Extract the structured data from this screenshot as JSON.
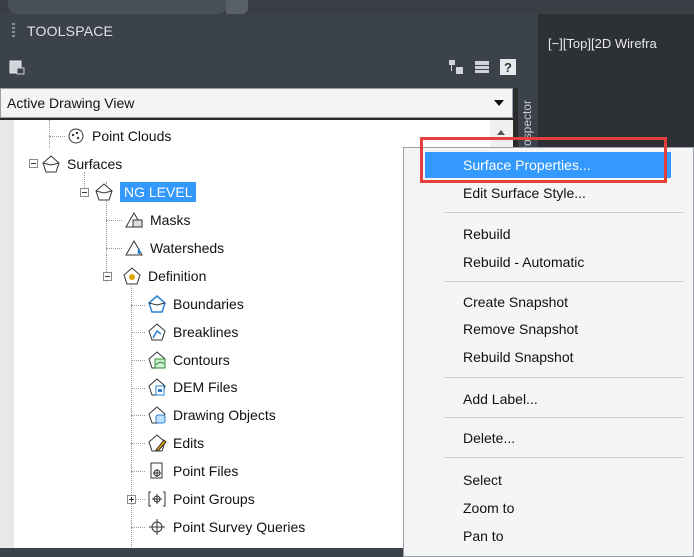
{
  "toolspace": {
    "title": "TOOLSPACE",
    "view_selector": "Active Drawing View",
    "side_tab": "Prospector"
  },
  "viewport": {
    "label": "[−][Top][2D Wirefra"
  },
  "tree": [
    {
      "label": "Point Clouds",
      "icon": "point-clouds-icon"
    },
    {
      "label": "Surfaces",
      "icon": "surfaces-icon"
    },
    {
      "label": "NG LEVEL",
      "icon": "surface-icon",
      "selected": true
    },
    {
      "label": "Masks",
      "icon": "masks-icon"
    },
    {
      "label": "Watersheds",
      "icon": "watersheds-icon"
    },
    {
      "label": "Definition",
      "icon": "definition-icon"
    },
    {
      "label": "Boundaries",
      "icon": "boundaries-icon"
    },
    {
      "label": "Breaklines",
      "icon": "breaklines-icon"
    },
    {
      "label": "Contours",
      "icon": "contours-icon"
    },
    {
      "label": "DEM Files",
      "icon": "dem-files-icon"
    },
    {
      "label": "Drawing Objects",
      "icon": "drawing-objects-icon"
    },
    {
      "label": "Edits",
      "icon": "edits-icon"
    },
    {
      "label": "Point Files",
      "icon": "point-files-icon"
    },
    {
      "label": "Point Groups",
      "icon": "point-groups-icon"
    },
    {
      "label": "Point Survey Queries",
      "icon": "point-survey-queries-icon"
    }
  ],
  "context_menu": {
    "items": [
      "Surface Properties...",
      "Edit Surface Style...",
      "Rebuild",
      "Rebuild - Automatic",
      "Create Snapshot",
      "Remove Snapshot",
      "Rebuild Snapshot",
      "Add Label...",
      "Delete...",
      "Select",
      "Zoom to",
      "Pan to"
    ],
    "highlighted": "Surface Properties..."
  },
  "colors": {
    "selection": "#3399ff",
    "highlight_box": "#e2403a",
    "panel_dark": "#3c424a"
  }
}
